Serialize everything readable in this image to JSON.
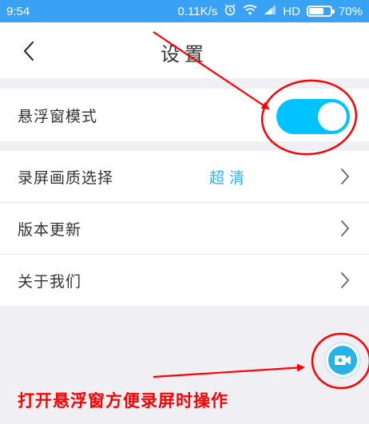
{
  "status_bar": {
    "time": "9:54",
    "speed": "0.11K/s",
    "network": "HD",
    "battery_label": "70%",
    "battery_level": 0.7,
    "icons": [
      "alarm-icon",
      "wifi-icon",
      "signal-icon",
      "battery-icon"
    ]
  },
  "header": {
    "back_icon": "chevron-left-icon",
    "title": "设置"
  },
  "settings": {
    "float_window": {
      "label": "悬浮窗模式",
      "enabled": true
    },
    "quality": {
      "label": "录屏画质选择",
      "value": "超清"
    },
    "update": {
      "label": "版本更新"
    },
    "about": {
      "label": "关于我们"
    }
  },
  "float_button": {
    "icon": "video-camera-icon"
  },
  "annotation": {
    "caption": "打开悬浮窗方便录屏时操作",
    "color": "#ff0000"
  },
  "colors": {
    "accent": "#29b6f6",
    "status_bar": "#3aa2f4",
    "toggle_on": "#00c3ff"
  }
}
